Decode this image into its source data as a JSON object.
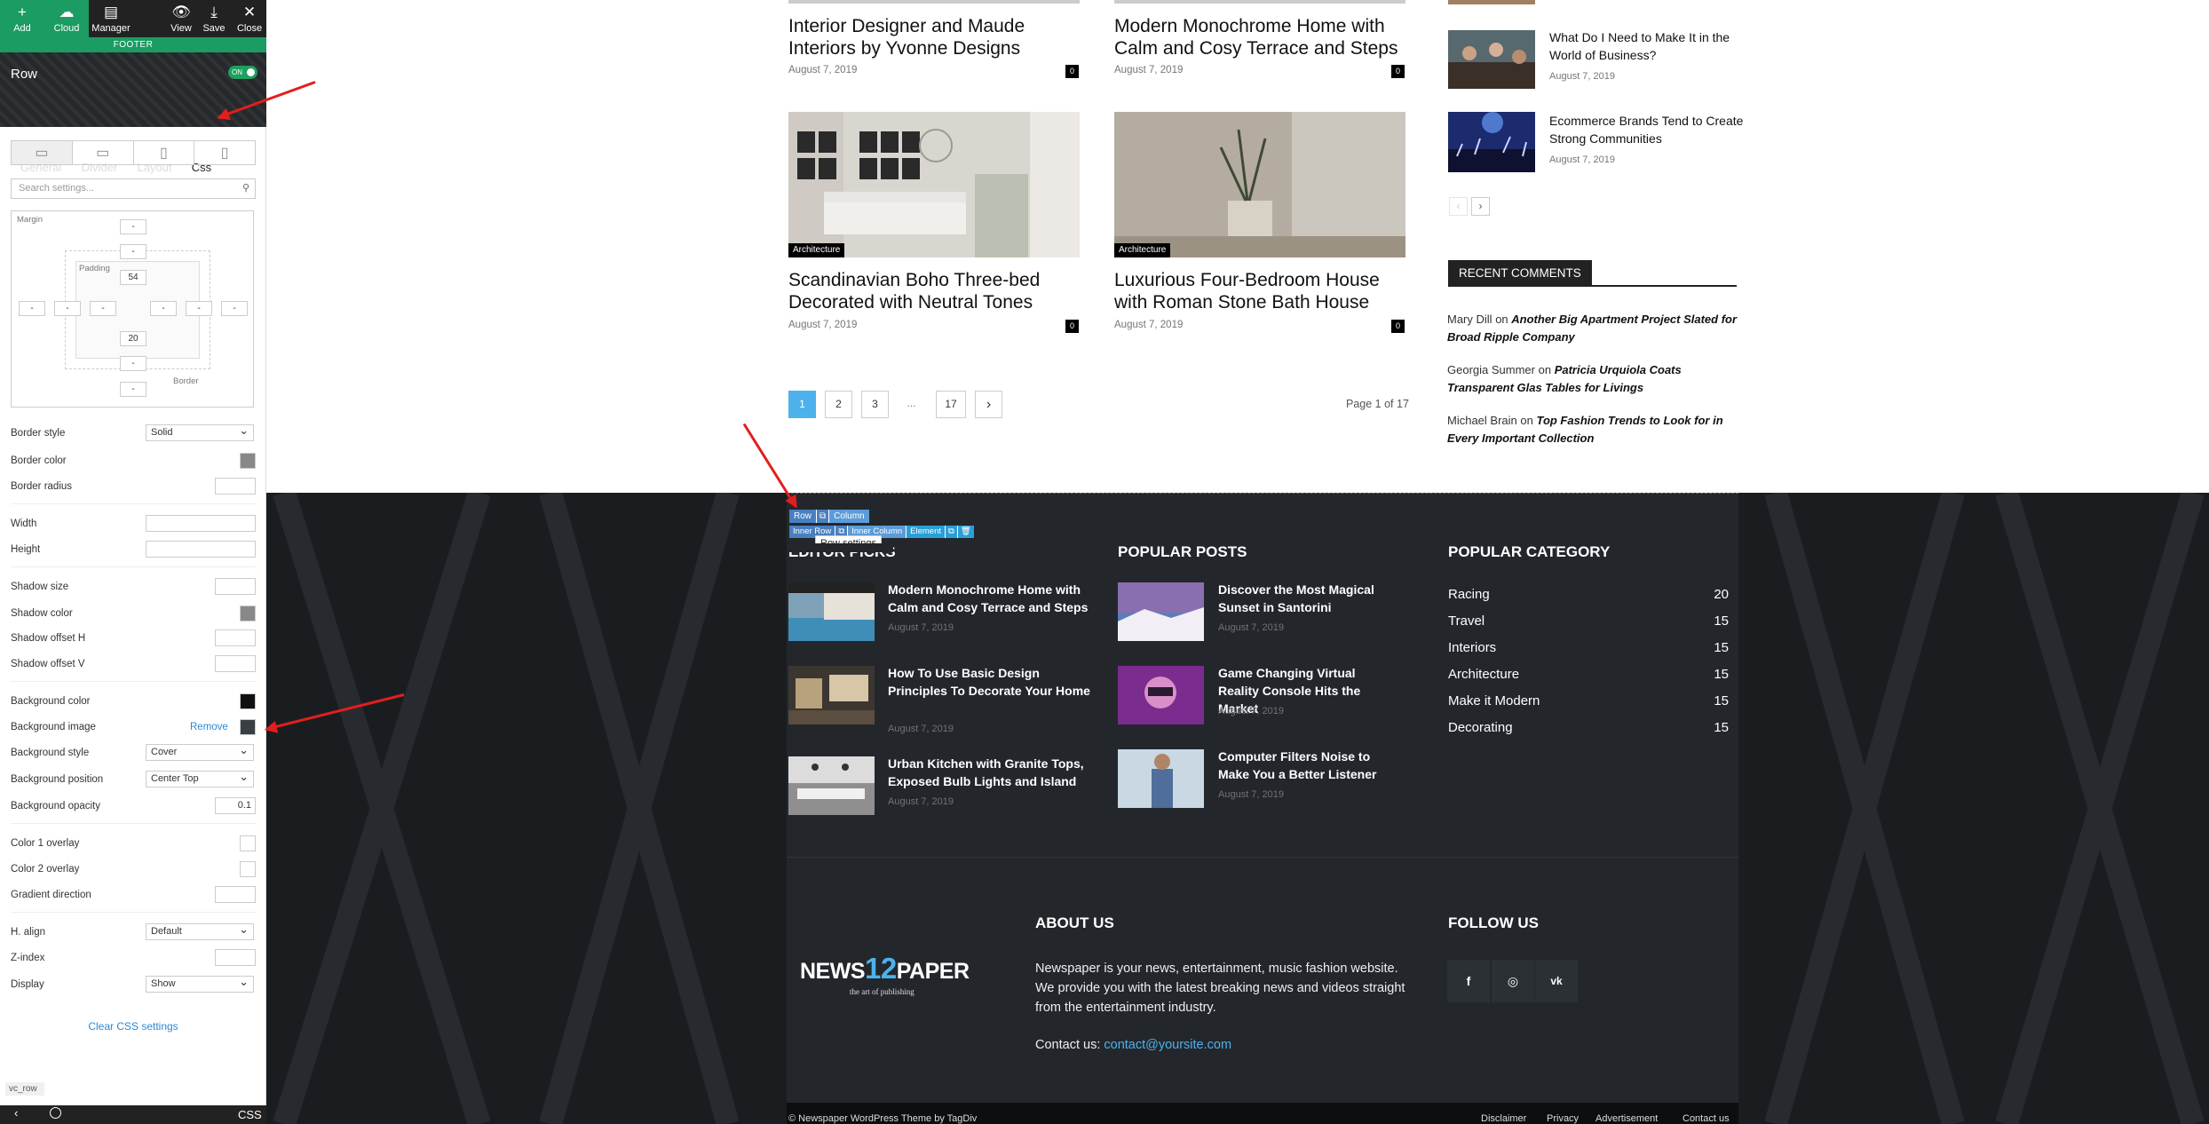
{
  "toolbar": {
    "add": "Add",
    "cloud": "Cloud",
    "manager": "Manager",
    "view": "View",
    "save": "Save",
    "close": "Close"
  },
  "panel": {
    "footer_label": "FOOTER",
    "row_title": "Row",
    "toggle": "ON",
    "tabs": [
      "General",
      "Divider",
      "Layout",
      "Css"
    ],
    "search_placeholder": "Search settings...",
    "spacing": {
      "margin_label": "Margin",
      "padding_label": "Padding",
      "border_label": "Border",
      "margin_top": "-",
      "padding_top": "-",
      "padding_top_val": "54",
      "margin_left": "-",
      "border_left": "-",
      "padding_left": "-",
      "padding_right": "-",
      "border_right": "-",
      "margin_right": "-",
      "padding_bottom_val": "20",
      "padding_bottom": "-",
      "margin_bottom": "-"
    },
    "border_style_label": "Border style",
    "border_style": "Solid",
    "border_color_label": "Border color",
    "border_color": "#888888",
    "border_radius_label": "Border radius",
    "width_label": "Width",
    "height_label": "Height",
    "shadow_size_label": "Shadow size",
    "shadow_color_label": "Shadow color",
    "shadow_color": "#888888",
    "shadow_h_label": "Shadow offset H",
    "shadow_v_label": "Shadow offset V",
    "bg_color_label": "Background color",
    "bg_color": "#111111",
    "bg_image_label": "Background image",
    "bg_image_remove": "Remove",
    "bg_style_label": "Background style",
    "bg_style": "Cover",
    "bg_position_label": "Background position",
    "bg_position": "Center Top",
    "bg_opacity_label": "Background opacity",
    "bg_opacity": "0.1",
    "color1_label": "Color 1 overlay",
    "color2_label": "Color 2 overlay",
    "gradient_label": "Gradient direction",
    "halign_label": "H. align",
    "halign": "Default",
    "zindex_label": "Z-index",
    "display_label": "Display",
    "display": "Show",
    "clear_css": "Clear CSS settings",
    "vc_row": "vc_row",
    "bottom_css": "CSS"
  },
  "posts": {
    "top_titles": [
      "Interior Designer and Maude Interiors by Yvonne Designs",
      "Modern Monochrome Home with Calm and Cosy Terrace and Steps"
    ],
    "top_dates": [
      "August 7, 2019",
      "August 7, 2019"
    ],
    "comments": [
      "0",
      "0",
      "0",
      "0"
    ],
    "cat": "Architecture",
    "mid_titles": [
      "Scandinavian Boho Three-bed Decorated with Neutral Tones",
      "Luxurious Four-Bedroom House with Roman Stone Bath House"
    ],
    "mid_dates": [
      "August 7, 2019",
      "August 7, 2019"
    ]
  },
  "pagination": {
    "pages": [
      "1",
      "2",
      "3",
      "...",
      "17"
    ],
    "next": "›",
    "info": "Page 1 of 17"
  },
  "sidebar": {
    "posts": [
      {
        "title": "What Do I Need to Make It in the World of Business?",
        "date": "August 7, 2019"
      },
      {
        "title": "Ecommerce Brands Tend to Create Strong Communities",
        "date": "August 7, 2019"
      }
    ],
    "prev": "‹",
    "next": "›",
    "recent_comments_title": "RECENT COMMENTS",
    "comments": [
      {
        "author": "Mary Dill",
        "on": "on",
        "post": "Another Big Apartment Project Slated for Broad Ripple Company"
      },
      {
        "author": "Georgia Summer",
        "on": "on",
        "post": "Patricia Urquiola Coats Transparent Glas Tables for Livings"
      },
      {
        "author": "Michael Brain",
        "on": "on",
        "post": "Top Fashion Trends to Look for in Every Important Collection"
      }
    ]
  },
  "builder": {
    "row": "Row",
    "column": "Column",
    "inner_row": "Inner Row",
    "inner_column": "Inner Column",
    "element": "Element",
    "tooltip": "Row settings"
  },
  "footer": {
    "editor_picks_title": "EDITOR PICKS",
    "editor_picks": [
      {
        "title": "Modern Monochrome Home with Calm and Cosy Terrace and Steps",
        "date": "August 7, 2019"
      },
      {
        "title": "How To Use Basic Design Principles To Decorate Your Home",
        "date": "August 7, 2019"
      },
      {
        "title": "Urban Kitchen with Granite Tops, Exposed Bulb Lights and Island",
        "date": "August 7, 2019"
      }
    ],
    "popular_posts_title": "POPULAR POSTS",
    "popular_posts": [
      {
        "title": "Discover the Most Magical Sunset in Santorini",
        "date": "August 7, 2019"
      },
      {
        "title": "Game Changing Virtual Reality Console Hits the Market",
        "date": "August 7, 2019"
      },
      {
        "title": "Computer Filters Noise to Make You a Better Listener",
        "date": "August 7, 2019"
      }
    ],
    "popular_category_title": "POPULAR CATEGORY",
    "categories": [
      {
        "name": "Racing",
        "count": "20"
      },
      {
        "name": "Travel",
        "count": "15"
      },
      {
        "name": "Interiors",
        "count": "15"
      },
      {
        "name": "Architecture",
        "count": "15"
      },
      {
        "name": "Make it Modern",
        "count": "15"
      },
      {
        "name": "Decorating",
        "count": "15"
      }
    ],
    "logo_news": "NEWS",
    "logo_num": "12",
    "logo_paper": "PAPER",
    "logo_tag": "the art of publishing",
    "about_title": "ABOUT US",
    "about_text": "Newspaper is your news, entertainment, music fashion website. We provide you with the latest breaking news and videos straight from the entertainment industry.",
    "contact_label": "Contact us:",
    "contact_email": "contact@yoursite.com",
    "follow_title": "FOLLOW US",
    "copyright": "© Newspaper WordPress Theme by TagDiv",
    "links": [
      "Disclaimer",
      "Privacy",
      "Advertisement",
      "Contact us"
    ]
  }
}
